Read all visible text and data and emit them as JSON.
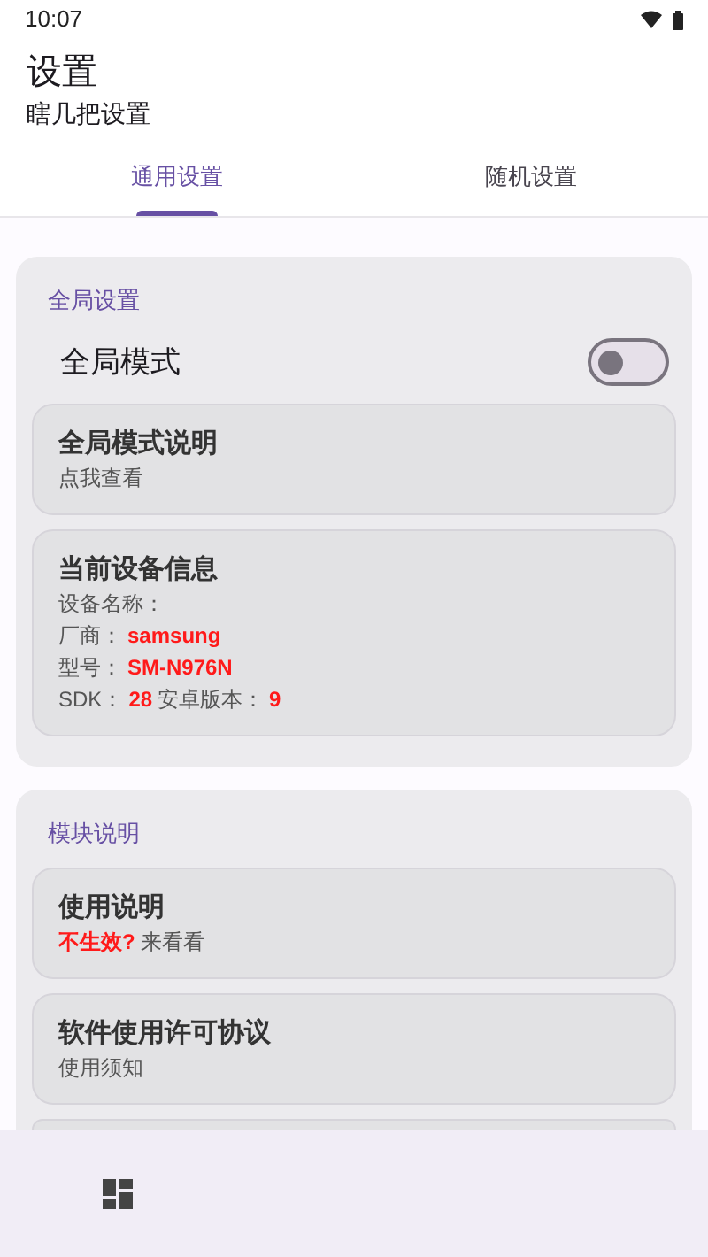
{
  "status_bar": {
    "time": "10:07"
  },
  "header": {
    "title": "设置",
    "subtitle": "瞎几把设置"
  },
  "tabs": [
    {
      "label": "通用设置",
      "selected": true
    },
    {
      "label": "随机设置",
      "selected": false
    }
  ],
  "sections": [
    {
      "title": "全局设置",
      "items": [
        {
          "kind": "switch",
          "label": "全局模式",
          "on": false
        },
        {
          "kind": "card",
          "title": "全局模式说明",
          "lines": [
            [
              {
                "text": "点我查看",
                "highlight": false
              }
            ]
          ]
        },
        {
          "kind": "card",
          "title": "当前设备信息",
          "lines": [
            [
              {
                "text": "设备名称：",
                "highlight": false
              }
            ],
            [
              {
                "text": "厂商：",
                "highlight": false
              },
              {
                "text": "samsung",
                "highlight": true
              }
            ],
            [
              {
                "text": "型号：",
                "highlight": false
              },
              {
                "text": "SM-N976N",
                "highlight": true
              }
            ],
            [
              {
                "text": "SDK：",
                "highlight": false
              },
              {
                "text": "28",
                "highlight": true
              },
              {
                "text": "安卓版本：",
                "highlight": false
              },
              {
                "text": "9",
                "highlight": true
              }
            ]
          ]
        }
      ]
    },
    {
      "title": "模块说明",
      "items": [
        {
          "kind": "card",
          "title": "使用说明",
          "lines": [
            [
              {
                "text": "不生效?",
                "highlight": true
              },
              {
                "text": "来看看",
                "highlight": false
              }
            ]
          ]
        },
        {
          "kind": "card",
          "title": "软件使用许可协议",
          "lines": [
            [
              {
                "text": "使用须知",
                "highlight": false
              }
            ]
          ]
        },
        {
          "kind": "card_edge"
        }
      ]
    }
  ]
}
